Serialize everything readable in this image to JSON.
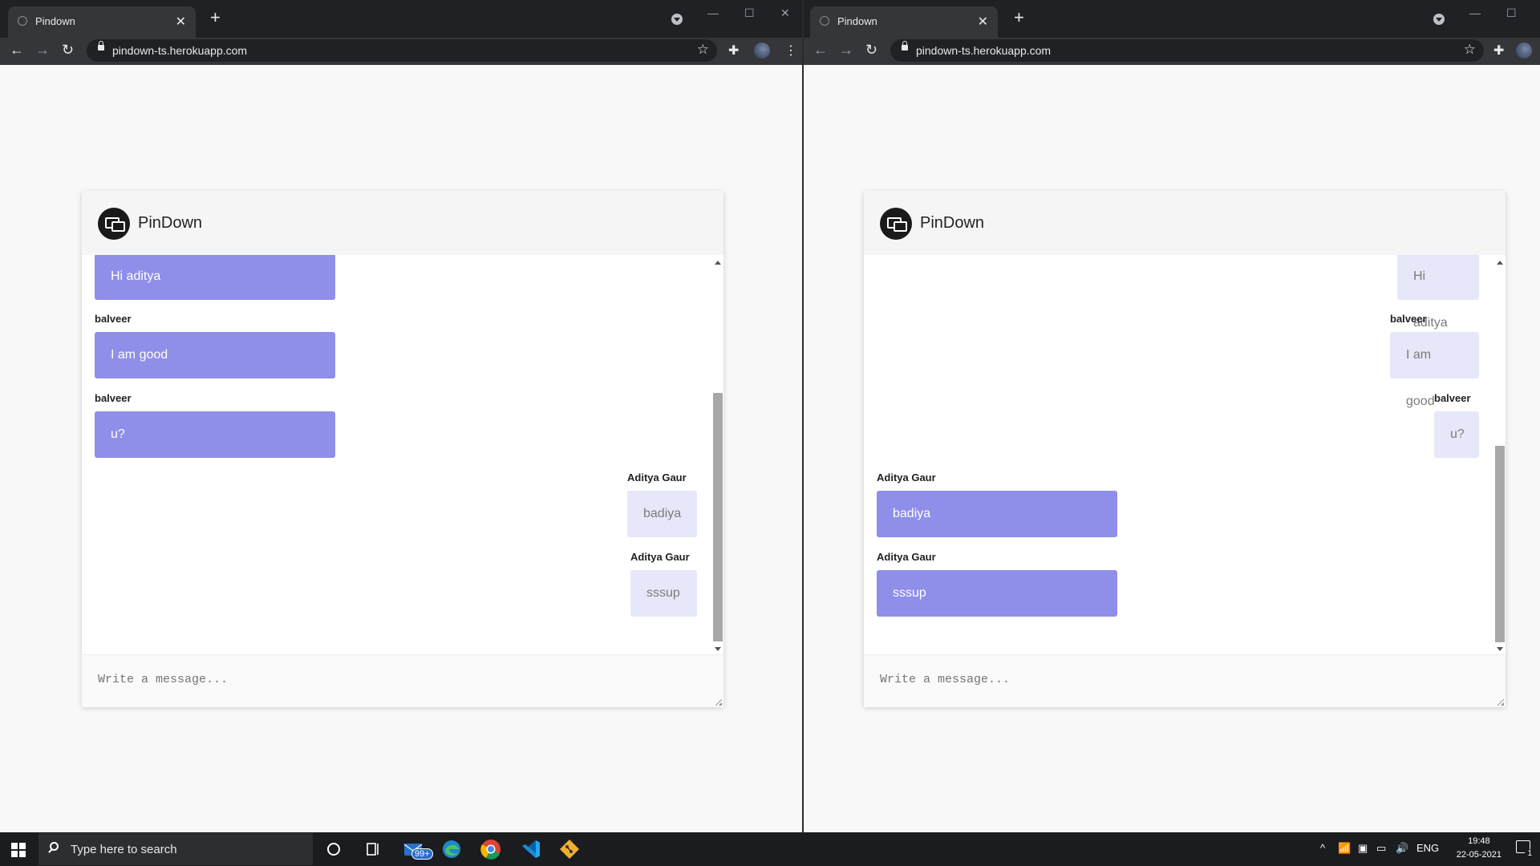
{
  "browser_left": {
    "tab_title": "Pindown",
    "url": "pindown-ts.herokuapp.com"
  },
  "browser_right": {
    "tab_title": "Pindown",
    "url": "pindown-ts.herokuapp.com"
  },
  "app": {
    "name": "PinDown",
    "composer_placeholder": "Write a message..."
  },
  "left_chat": {
    "messages": [
      {
        "sender": "",
        "text": "Hi aditya"
      },
      {
        "sender": "balveer",
        "text": "I am good"
      },
      {
        "sender": "balveer",
        "text": "u?"
      },
      {
        "sender": "Aditya Gaur",
        "text": "badiya"
      },
      {
        "sender": "Aditya Gaur",
        "text": "sssup"
      }
    ]
  },
  "right_chat": {
    "messages": [
      {
        "sender": "",
        "text": "Hi aditya"
      },
      {
        "sender": "balveer",
        "text": "I am good"
      },
      {
        "sender": "balveer",
        "text": "u?"
      },
      {
        "sender": "Aditya Gaur",
        "text": "badiya"
      },
      {
        "sender": "Aditya Gaur",
        "text": "sssup"
      }
    ]
  },
  "taskbar": {
    "search_placeholder": "Type here to search",
    "mail_badge": "99+",
    "language": "ENG",
    "time": "19:48",
    "date": "22-05-2021",
    "notification_count": "1"
  },
  "colors": {
    "other_bubble": "#8f8ee8",
    "self_bubble": "#e7e7fa",
    "browser_chrome": "#35363a"
  },
  "icons": [
    "chrome-icon",
    "edge-icon",
    "mail-icon",
    "vscode-icon",
    "git-icon",
    "cortana-icon",
    "task-view-icon",
    "windows-icon"
  ]
}
